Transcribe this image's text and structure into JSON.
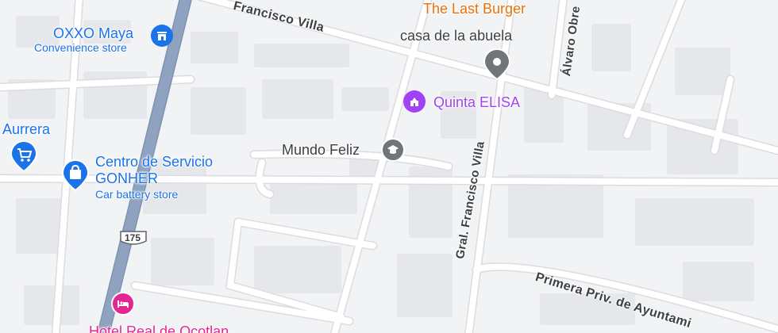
{
  "map": {
    "colors": {
      "background": "#f2f3f5",
      "block": "#e6e7ea",
      "minor_road": "#ffffff",
      "road_outline": "#dadce0",
      "highway": "#8fa3c0",
      "shopping_pin": "#1a73e8",
      "landmark_pin": "#a142f4",
      "food_label": "#e8710a",
      "generic_pin": "#70757a",
      "lodging_pin": "#e52592"
    },
    "places": [
      {
        "name": "OXXO Maya",
        "category": "Convenience store",
        "icon": "store-icon"
      },
      {
        "name": "Aurrera",
        "icon": "shopping-cart-icon"
      },
      {
        "name": "Centro de Servicio",
        "name_line2": "GONHER",
        "category": "Car battery store",
        "icon": "shopping-bag-icon"
      },
      {
        "name": "The Last Burger",
        "icon": "restaurant-icon"
      },
      {
        "name": "casa de la abuela",
        "icon": "generic-pin-icon"
      },
      {
        "name": "Quinta ELISA",
        "icon": "event-venue-icon"
      },
      {
        "name": "Mundo Feliz",
        "icon": "school-icon"
      },
      {
        "name": "Hotel Real de Ocotlan",
        "icon": "hotel-icon"
      }
    ],
    "streets": [
      {
        "name": "Francisco Villa"
      },
      {
        "name": "Gral. Francisco Villa"
      },
      {
        "name": "Álvaro Obre"
      },
      {
        "name": "Primera Priv. de Ayuntami"
      }
    ],
    "highway_shield": {
      "number": "175"
    }
  }
}
